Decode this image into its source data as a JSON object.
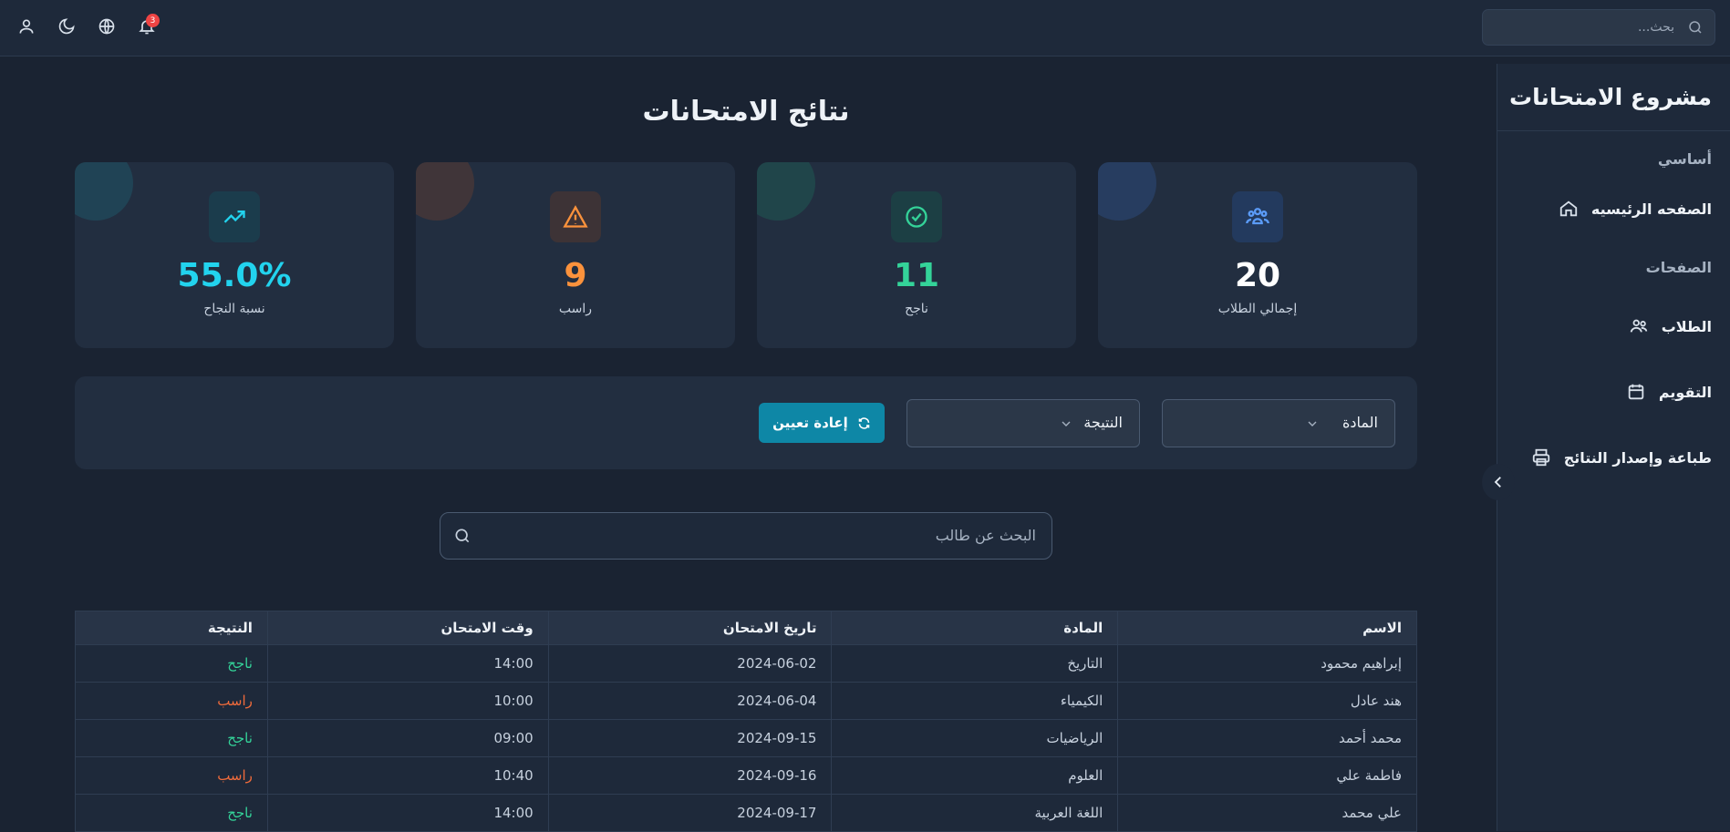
{
  "topbar": {
    "search_placeholder": "بحث...",
    "notification_count": "3"
  },
  "sidebar": {
    "brand": "مشروع الامتحانات",
    "sections": [
      "أساسي",
      "الصفحات"
    ],
    "items": [
      {
        "label": "الصفحه الرئيسيه",
        "icon": "home-icon"
      },
      {
        "label": "الطلاب",
        "icon": "users-icon"
      },
      {
        "label": "التقويم",
        "icon": "calendar-icon"
      },
      {
        "label": "طباعة وإصدار النتائج",
        "icon": "printer-icon"
      }
    ]
  },
  "main": {
    "title": "نتائج الامتحانات",
    "stats": [
      {
        "label": "إجمالي الطلاب",
        "value": "20",
        "color": "#ffffff",
        "accent": "#3b82f6",
        "icon": "users-icon"
      },
      {
        "label": "ناجح",
        "value": "11",
        "color": "#34d399",
        "accent": "#10b981",
        "icon": "check-circle-icon"
      },
      {
        "label": "راسب",
        "value": "9",
        "color": "#fb923c",
        "accent": "#f97316",
        "icon": "warning-icon"
      },
      {
        "label": "نسبة النجاح",
        "value": "55.0%",
        "color": "#22d3ee",
        "accent": "#06b6d4",
        "icon": "trending-up-icon"
      }
    ],
    "filters": {
      "subject_label": "المادة",
      "result_label": "النتيجة",
      "reset_label": "إعادة تعيين"
    },
    "student_search_placeholder": "البحث عن طالب",
    "table": {
      "columns": [
        "الاسم",
        "المادة",
        "تاريخ الامتحان",
        "وقت الامتحان",
        "النتيجة"
      ],
      "rows": [
        [
          "إبراهيم محمود",
          "التاريخ",
          "2024-06-02",
          "14:00",
          "ناجح"
        ],
        [
          "هند عادل",
          "الكيمياء",
          "2024-06-04",
          "10:00",
          "راسب"
        ],
        [
          "محمد أحمد",
          "الرياضيات",
          "2024-09-15",
          "09:00",
          "ناجح"
        ],
        [
          "فاطمة علي",
          "العلوم",
          "2024-09-16",
          "10:40",
          "راسب"
        ],
        [
          "علي محمد",
          "اللغة العربية",
          "2024-09-17",
          "14:00",
          "ناجح"
        ]
      ]
    }
  }
}
